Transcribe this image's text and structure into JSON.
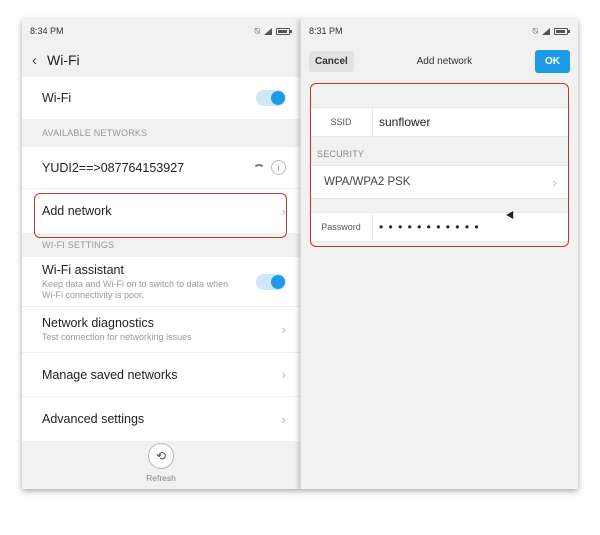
{
  "left": {
    "status_time": "8:34 PM",
    "header_title": "Wi-Fi",
    "wifi_label": "Wi-Fi",
    "section_available": "AVAILABLE NETWORKS",
    "network_name": "YUDI2==>087764153927",
    "add_network_label": "Add network",
    "section_settings": "WI-FI SETTINGS",
    "assistant_label": "Wi-Fi assistant",
    "assistant_sub": "Keep data and Wi-Fi on to switch to data when Wi-Fi connectivity is poor.",
    "diagnostics_label": "Network diagnostics",
    "diagnostics_sub": "Test connection for networking issues",
    "saved_label": "Manage saved networks",
    "advanced_label": "Advanced settings",
    "refresh_label": "Refresh",
    "info_glyph": "i",
    "refresh_glyph": "⟲"
  },
  "right": {
    "status_time": "8:31 PM",
    "cancel_label": "Cancel",
    "title": "Add network",
    "ok_label": "OK",
    "ssid_label": "SSID",
    "ssid_value": "sunflower",
    "security_section": "SECURITY",
    "security_value": "WPA/WPA2 PSK",
    "password_label": "Password",
    "password_value": "• • • • • • • • • • •"
  },
  "colors": {
    "accent": "#1e9be6",
    "highlight": "#c0392b",
    "background": "#f1f1f1"
  },
  "icons": {
    "back": "chevron-left-icon",
    "chevron": "chevron-right-icon",
    "wifi": "wifi-signal-icon",
    "info": "info-icon",
    "refresh": "refresh-icon",
    "mute": "mute-icon",
    "battery": "battery-icon",
    "signal": "signal-icon"
  }
}
